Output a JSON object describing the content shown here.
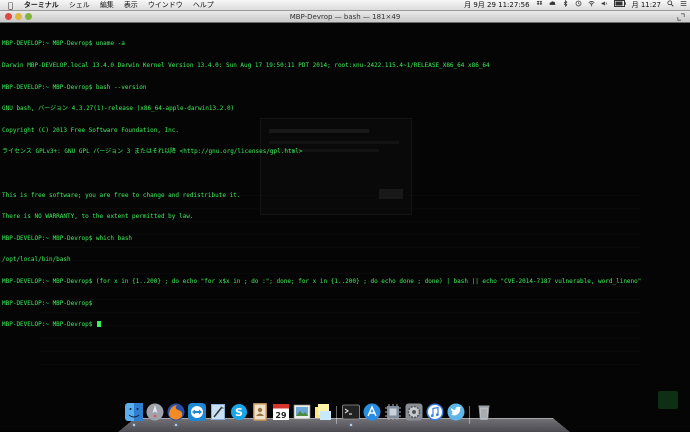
{
  "menubar": {
    "app": "ターミナル",
    "items": [
      "シェル",
      "編集",
      "表示",
      "ウインドウ",
      "ヘルプ"
    ],
    "datetime": "月 9月 29  11:27:56",
    "clock": "月 11:27"
  },
  "window": {
    "title": "MBP-Devrop — bash — 181×49"
  },
  "terminal": {
    "lines": [
      "MBP-DEVELOP:~ MBP-Devrop$ uname -a",
      "Darwin MBP-DEVELOP.local 13.4.0 Darwin Kernel Version 13.4.0: Sun Aug 17 19:50:11 PDT 2014; root:xnu-2422.115.4~1/RELEASE_X86_64 x86_64",
      "MBP-DEVELOP:~ MBP-Devrop$ bash --version",
      "GNU bash, バージョン 4.3.27(1)-release (x86_64-apple-darwin13.2.0)",
      "Copyright (C) 2013 Free Software Foundation, Inc.",
      "ライセンス GPLv3+: GNU GPL バージョン 3 またはそれ以降 <http://gnu.org/licenses/gpl.html>",
      "",
      "This is free software; you are free to change and redistribute it.",
      "There is NO WARRANTY, to the extent permitted by law.",
      "MBP-DEVELOP:~ MBP-Devrop$ which bash",
      "/opt/local/bin/bash",
      "MBP-DEVELOP:~ MBP-Devrop$ (for x in {1..200} ; do echo \"for x$x in ; do :\"; done; for x in {1..200} ; do echo done ; done) | bash || echo \"CVE-2014-7187 vulnerable, word_lineno\"",
      "MBP-DEVELOP:~ MBP-Devrop$ ",
      "MBP-DEVELOP:~ MBP-Devrop$ "
    ]
  },
  "dock": {
    "apps": [
      {
        "icon": "finder-icon",
        "running": true
      },
      {
        "icon": "launchpad-icon",
        "running": false
      },
      {
        "icon": "firefox-icon",
        "running": true
      },
      {
        "icon": "teamviewer-icon",
        "running": false
      },
      {
        "icon": "xcode-icon",
        "running": false
      },
      {
        "icon": "skype-icon",
        "running": false
      },
      {
        "icon": "contacts-icon",
        "running": false
      },
      {
        "icon": "calendar-icon",
        "running": false
      },
      {
        "icon": "photo-icon",
        "running": false
      },
      {
        "icon": "stickies-icon",
        "running": false
      },
      {
        "icon": "terminal-icon",
        "running": true
      },
      {
        "icon": "app-store-icon",
        "running": false
      },
      {
        "icon": "chip-icon",
        "running": false
      },
      {
        "icon": "system-preferences-icon",
        "running": false
      },
      {
        "icon": "itunes-icon",
        "running": false
      },
      {
        "icon": "twitter-icon",
        "running": false
      }
    ],
    "calendar_day": "29",
    "trash_icon": "trash-icon"
  },
  "colors": {
    "terminal_fg": "#3cf05a",
    "terminal_bg": "#050505"
  }
}
